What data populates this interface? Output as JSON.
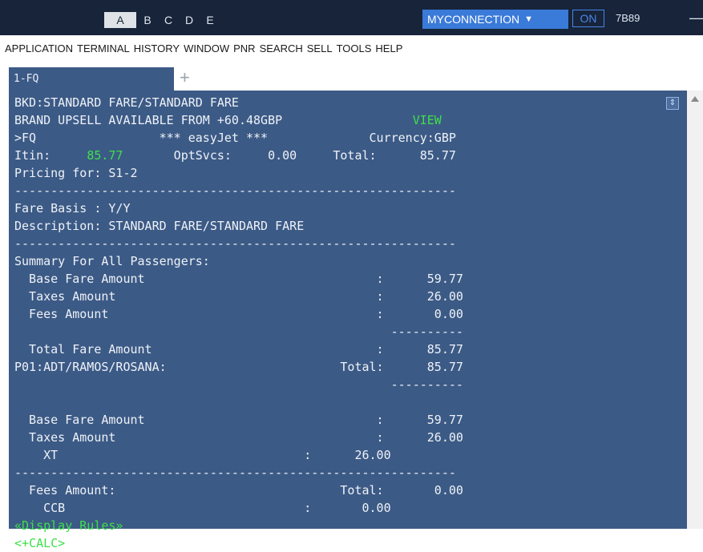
{
  "session_tabs": [
    "A",
    "B",
    "C",
    "D",
    "E"
  ],
  "active_session": "A",
  "connection": {
    "label": "MYCONNECTION",
    "on_label": "ON",
    "code": "7B89"
  },
  "menu": [
    "APPLICATION",
    "TERMINAL",
    "HISTORY",
    "WINDOW",
    "PNR",
    "SEARCH",
    "SELL",
    "TOOLS",
    "HELP"
  ],
  "terminal_tab": {
    "label": "1-FQ",
    "add_label": "+"
  },
  "terminal": {
    "l1": "BKD:STANDARD FARE/STANDARD FARE",
    "l2": "BRAND UPSELL AVAILABLE FROM +60.48GBP",
    "l2_link": "VIEW",
    "l3": ">FQ                 *** easyJet ***              Currency:GBP",
    "l4a": "Itin:     ",
    "l4_amt": "85.77",
    "l4b": "       OptSvcs:     0.00     Total:      85.77",
    "l5": "Pricing for: S1-2",
    "sep1": "-------------------------------------------------------------",
    "l6": "Fare Basis : Y/Y",
    "l7": "Description: STANDARD FARE/STANDARD FARE",
    "sep2": "-------------------------------------------------------------",
    "l8": "Summary For All Passengers:",
    "l9": "  Base Fare Amount                                :      59.77",
    "l10": "  Taxes Amount                                    :      26.00",
    "l11": "  Fees Amount                                     :       0.00",
    "l12": "                                                    ----------",
    "l13": "  Total Fare Amount                               :      85.77",
    "l14": "P01:ADT/RAMOS/ROSANA:                        Total:      85.77",
    "l15": "                                                    ----------",
    "l16": "",
    "l17": "  Base Fare Amount                                :      59.77",
    "l18": "  Taxes Amount                                    :      26.00",
    "l19": "    XT                                  :      26.00",
    "sep3": "-------------------------------------------------------------",
    "l20": "  Fees Amount:                               Total:       0.00",
    "l21": "    CCB                                 :       0.00",
    "link_rules": "«Display Rules»",
    "link_calc": "<+CALC>"
  }
}
